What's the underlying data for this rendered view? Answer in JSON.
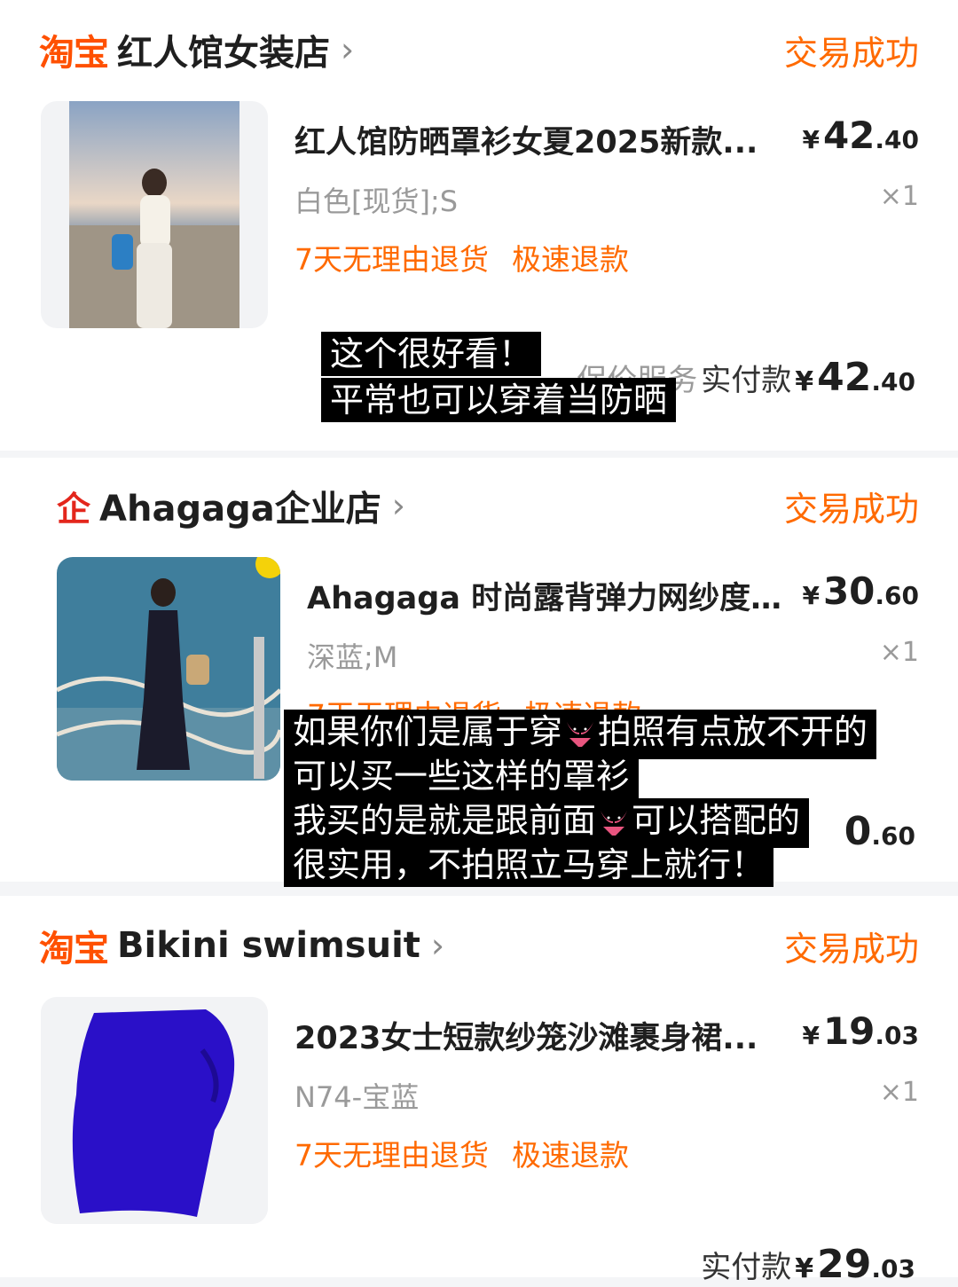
{
  "orders": [
    {
      "platform_logo": "淘宝",
      "shop_name": "红人馆女装店",
      "status": "交易成功",
      "product": {
        "title": "红人馆防晒罩衫女夏2025新款...",
        "price_currency": "¥",
        "price_int": "42",
        "price_dec": ".40",
        "spec": "白色[现货];S",
        "qty": "×1",
        "tags": [
          "7天无理由退货",
          "极速退款"
        ]
      },
      "partially_hidden_text": "保价服务",
      "total": {
        "label": "实付款",
        "currency": "¥",
        "int": "42",
        "dec": ".40"
      }
    },
    {
      "platform_logo": "企",
      "shop_name": "Ahagaga企业店",
      "status": "交易成功",
      "product": {
        "title": "Ahagaga 时尚露背弹力网纱度...",
        "price_currency": "¥",
        "price_int": "30",
        "price_dec": ".60",
        "spec": "深蓝;M",
        "qty": "×1",
        "tags": [
          "7天无理由退货",
          "极速退款"
        ]
      },
      "total": {
        "int_visible": "0",
        "dec": ".60"
      }
    },
    {
      "platform_logo": "淘宝",
      "shop_name": "Bikini swimsuit",
      "status": "交易成功",
      "product": {
        "title": "2023女士短款纱笼沙滩裹身裙...",
        "price_currency": "¥",
        "price_int": "19",
        "price_dec": ".03",
        "spec": "N74-宝蓝",
        "qty": "×1",
        "tags": [
          "7天无理由退货",
          "极速退款"
        ]
      },
      "total": {
        "label": "实付款",
        "currency": "¥",
        "int": "29",
        "dec": ".03"
      }
    }
  ],
  "captions": {
    "caption1_line1": "这个很好看！",
    "caption1_line2": "平常也可以穿着当防晒",
    "caption2_line1_a": "如果你们是属于穿",
    "caption2_line1_b": "拍照有点放不开的",
    "caption2_line2": "可以买一些这样的罩衫",
    "caption2_line3_a": "我买的是就是跟前面",
    "caption2_line3_b": "可以搭配的",
    "caption2_line4": "很实用，不拍照立马穿上就行！"
  },
  "icons": {
    "chevron": "chevron-right-icon",
    "bikini": "bikini-emoji-icon"
  },
  "colors": {
    "accent": "#ff6a00",
    "taobao": "#ff5000",
    "enterprise_red": "#e3261c",
    "caption_bg": "#000000",
    "caption_text": "#ffffff"
  }
}
